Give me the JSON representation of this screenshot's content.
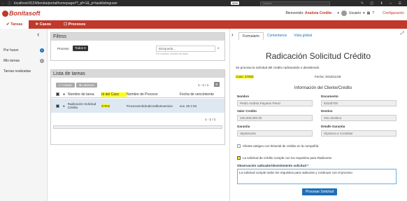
{
  "browser": {
    "url": "localhost:8124/bonita/portal/homepage#?_pf=1&_p=tasklistinguser",
    "zoom": "30%",
    "search_placeholder": "Search"
  },
  "app": {
    "brand": "Bonitasoft",
    "welcome": "Bienvenido:",
    "user_name": "Analista Credito",
    "user_menu": "Usuario",
    "config": "Configuración"
  },
  "menu": [
    {
      "label": "Tareas"
    },
    {
      "label": "Casos"
    },
    {
      "label": "Procesos"
    }
  ],
  "sidebar": {
    "items": [
      {
        "label": "Por hacer",
        "count": "1"
      },
      {
        "label": "Mis tareas",
        "count": "1"
      },
      {
        "label": "Tareas realizadas",
        "count": ""
      }
    ]
  },
  "filters": {
    "title": "Filtros",
    "process_label": "Proceso",
    "process_value": "Todos",
    "search_placeholder": "Búsqueda...",
    "search_hint": "Por nombre, nombre de tarea"
  },
  "tasklist": {
    "title": "Lista de tareas",
    "take": "TOMAR",
    "release": "LIBERAR",
    "pager": "1 - 1 / 1",
    "cols": [
      "Nombre de tarea",
      "Id del Caso",
      "Nombre de Proceso",
      "Fecha de vencimiento"
    ],
    "row": {
      "task": "Radicación Solicitud Crédito",
      "case": "37002",
      "process": "ProcesoSolicitudCreditoInversion",
      "due": "nov. 28 1:53"
    }
  },
  "form": {
    "tabs": [
      "Formulario",
      "Comentarios",
      "Vista global"
    ],
    "title": "Radicación Solicitud Crédito",
    "intro": "Se procesa la solicitud del credito radicandolo o desistiendo",
    "case_label": "Caso: 37002",
    "date_label": "Fecha: 2016/11/28",
    "section": "Información del Cliente/Crédito",
    "nombre_l": "Nombre",
    "nombre_v": "Pedro Andrea Payares Perez",
    "doc_l": "Documento",
    "doc_v": "91526700",
    "valor_l": "Valor Credito",
    "valor_v": "100,000,000.00",
    "destino_l": "Destino",
    "destino_v": "Otro Destino",
    "garantia_l": "Garantia",
    "garantia_v": "Hipotecaria",
    "detalle_l": "Detalle Garantia",
    "detalle_v": "Hipoteca a Constituir",
    "chk1": "Cliente antiguo con historial de crédito en la compañía",
    "chk2": "La solicitud de crédito cumple con los requisitos para Radicarse",
    "obs_l": "Observación radicador/desistimiento solicitud *",
    "obs_v": "La solicitud cumple todos los requisitos para radicarse y continuar con el proceso",
    "submit": "Procesar Solicitud"
  }
}
